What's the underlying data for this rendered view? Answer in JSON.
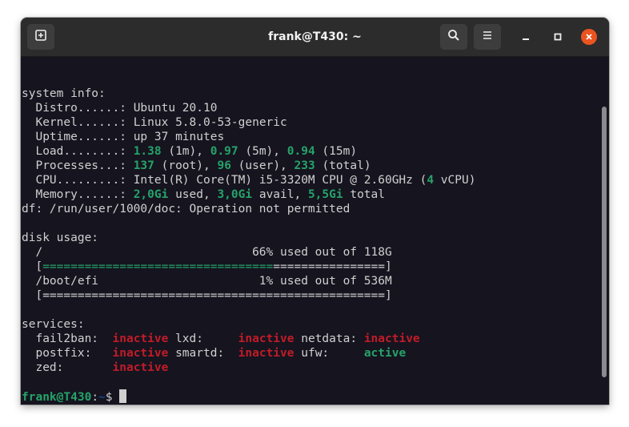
{
  "window": {
    "title": "frank@T430: ~",
    "buttons": {
      "new_tab_icon": "new-tab-icon",
      "search_icon": "search-icon",
      "menu_icon": "hamburger-menu-icon",
      "minimize_icon": "minimize-icon",
      "maximize_icon": "maximize-icon",
      "close_icon": "close-icon"
    }
  },
  "colors": {
    "terminal_bg": "#15141f",
    "text": "#d0d0d0",
    "green": "#26a269",
    "red": "#c01c28",
    "blue": "#12488b",
    "close": "#e95420",
    "titlebar": "#2c2c2c"
  },
  "system_info": {
    "header": "system info:",
    "distro_label": "  Distro......: ",
    "distro_value": "Ubuntu 20.10",
    "kernel_label": "  Kernel......: ",
    "kernel_value": "Linux 5.8.0-53-generic",
    "uptime_label": "  Uptime......: ",
    "uptime_value": "up 37 minutes",
    "load_label": "  Load........: ",
    "load_1": "1.38",
    "load_1_unit": " (1m), ",
    "load_5": "0.97",
    "load_5_unit": " (5m), ",
    "load_15": "0.94",
    "load_15_unit": " (15m)",
    "processes_label": "  Processes...: ",
    "proc_root": "137",
    "proc_root_unit": " (root), ",
    "proc_user": "96",
    "proc_user_unit": " (user), ",
    "proc_total": "233",
    "proc_total_unit": " (total)",
    "cpu_label": "  CPU.........: ",
    "cpu_value": "Intel(R) Core(TM) i5-3320M CPU @ 2.60GHz (",
    "cpu_count": "4",
    "cpu_suffix": " vCPU)",
    "memory_label": "  Memory......: ",
    "mem_used": "2,0Gi",
    "mem_used_unit": " used, ",
    "mem_avail": "3,0Gi",
    "mem_avail_unit": " avail, ",
    "mem_total": "5,5Gi",
    "mem_total_unit": " total"
  },
  "df_error": "df: /run/user/1000/doc: Operation not permitted",
  "disk_usage": {
    "header": "disk usage:",
    "disks": [
      {
        "line": "  /                              66% used out of 118G",
        "bar_open": "  [",
        "bar_used": "=================================",
        "bar_free": "================",
        "bar_close": "]",
        "used_fraction": 0.66
      },
      {
        "line": "  /boot/efi                       1% used out of 536M",
        "bar_open": "  [",
        "bar_used": "",
        "bar_free": "=================================================",
        "bar_close": "]",
        "used_fraction": 0.01
      }
    ]
  },
  "services": {
    "header": "services:",
    "rows": [
      [
        {
          "name": "  fail2ban:  ",
          "status": "inactive",
          "pad": " "
        },
        {
          "name": "lxd:     ",
          "status": "inactive",
          "pad": " "
        },
        {
          "name": "netdata: ",
          "status": "inactive",
          "pad": ""
        }
      ],
      [
        {
          "name": "  postfix:   ",
          "status": "inactive",
          "pad": " "
        },
        {
          "name": "smartd:  ",
          "status": "inactive",
          "pad": " "
        },
        {
          "name": "ufw:     ",
          "status": "active",
          "pad": ""
        }
      ],
      [
        {
          "name": "  zed:       ",
          "status": "inactive",
          "pad": ""
        }
      ]
    ]
  },
  "prompt": {
    "user_host": "frank@T430",
    "colon": ":",
    "path": "~",
    "symbol": "$ "
  }
}
